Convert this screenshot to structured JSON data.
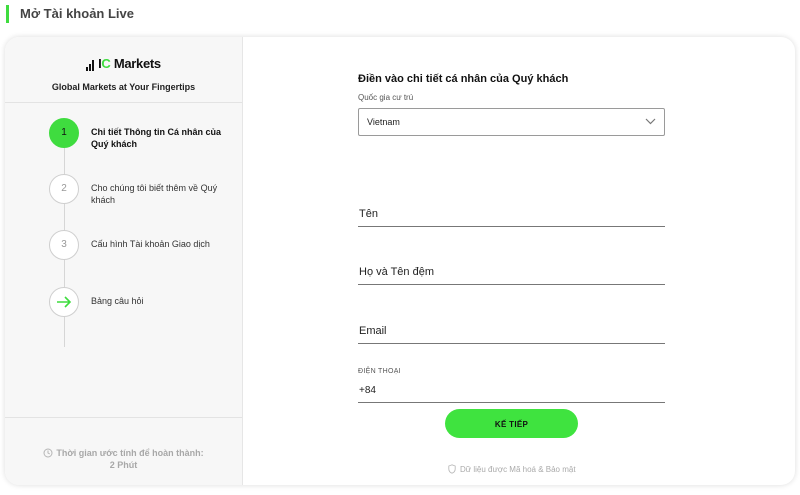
{
  "header": {
    "title": "Mở Tài khoản Live"
  },
  "brand": {
    "logo_prefix": "I",
    "logo_accent": "C",
    "logo_suffix": " Markets",
    "tagline": "Global Markets at Your Fingertips"
  },
  "steps": [
    {
      "number": "1",
      "label": "Chi tiết Thông tin Cá nhân của Quý khách",
      "state": "active"
    },
    {
      "number": "2",
      "label": "Cho chúng tôi biết thêm về Quý khách",
      "state": "pending"
    },
    {
      "number": "3",
      "label": "Cấu hình Tài khoản Giao dịch",
      "state": "pending"
    },
    {
      "number": "",
      "label": "Bảng câu hỏi",
      "state": "arrow",
      "icon": "arrow-right-icon"
    }
  ],
  "time_estimate": {
    "line1": "Thời gian ước tính để hoàn thành:",
    "line2": "2 Phút"
  },
  "form": {
    "title": "Điền vào chi tiết cá nhân của Quý khách",
    "country_label": "Quốc gia cư trú",
    "country_value": "Vietnam",
    "first_name_placeholder": "Tên",
    "last_name_placeholder": "Họ và Tên đệm",
    "email_placeholder": "Email",
    "phone_label": "ĐIỆN THOẠI",
    "phone_prefix": "+84",
    "next_label": "KẾ TIẾP",
    "secure_note": "Dữ liệu được Mã hoá & Bảo mật"
  },
  "colors": {
    "accent": "#3fdc3f",
    "sidebar_bg": "#f7f7f7"
  }
}
